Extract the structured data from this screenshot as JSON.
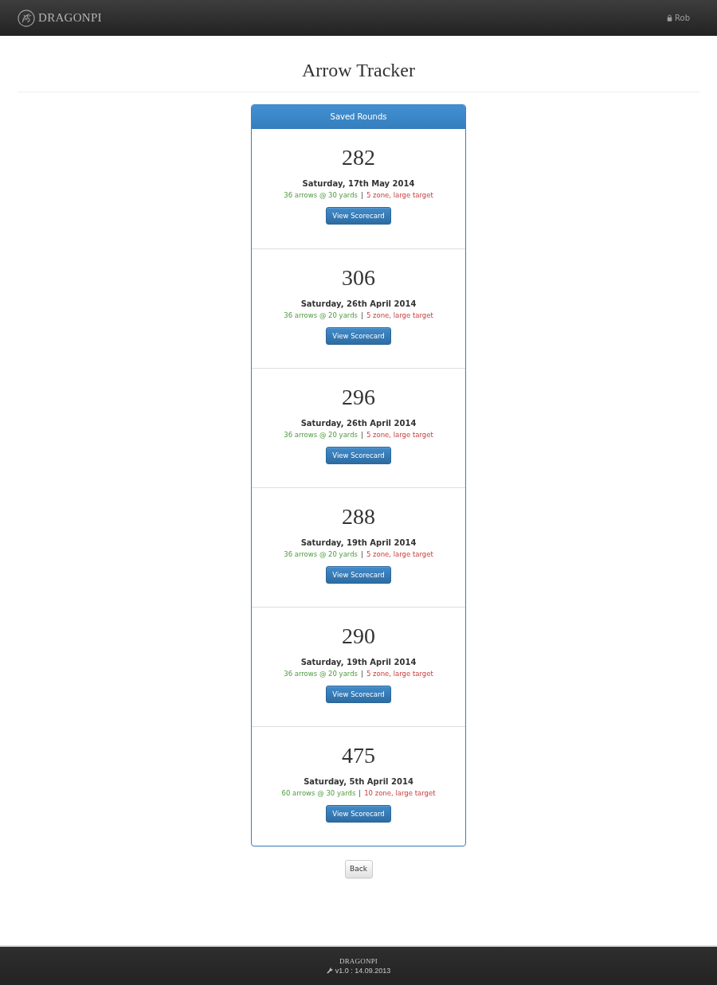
{
  "navbar": {
    "brand": "DRAGONPI",
    "user": "Rob"
  },
  "page_title": "Arrow Tracker",
  "panel": {
    "title": "Saved Rounds",
    "rounds": [
      {
        "score": "282",
        "date": "Saturday, 17th May 2014",
        "arrows": "36 arrows @ 30 yards",
        "separator": "|",
        "target": "5 zone, large target",
        "button": "View Scorecard"
      },
      {
        "score": "306",
        "date": "Saturday, 26th April 2014",
        "arrows": "36 arrows @ 20 yards",
        "separator": "|",
        "target": "5 zone, large target",
        "button": "View Scorecard"
      },
      {
        "score": "296",
        "date": "Saturday, 26th April 2014",
        "arrows": "36 arrows @ 20 yards",
        "separator": "|",
        "target": "5 zone, large target",
        "button": "View Scorecard"
      },
      {
        "score": "288",
        "date": "Saturday, 19th April 2014",
        "arrows": "36 arrows @ 20 yards",
        "separator": "|",
        "target": "5 zone, large target",
        "button": "View Scorecard"
      },
      {
        "score": "290",
        "date": "Saturday, 19th April 2014",
        "arrows": "36 arrows @ 20 yards",
        "separator": "|",
        "target": "5 zone, large target",
        "button": "View Scorecard"
      },
      {
        "score": "475",
        "date": "Saturday, 5th April 2014",
        "arrows": "60 arrows @ 30 yards",
        "separator": "|",
        "target": "10 zone, large target",
        "button": "View Scorecard"
      }
    ]
  },
  "back_button": "Back",
  "footer": {
    "brand": "DRAGONPI",
    "version": "v1.0 : 14.09.2013"
  }
}
